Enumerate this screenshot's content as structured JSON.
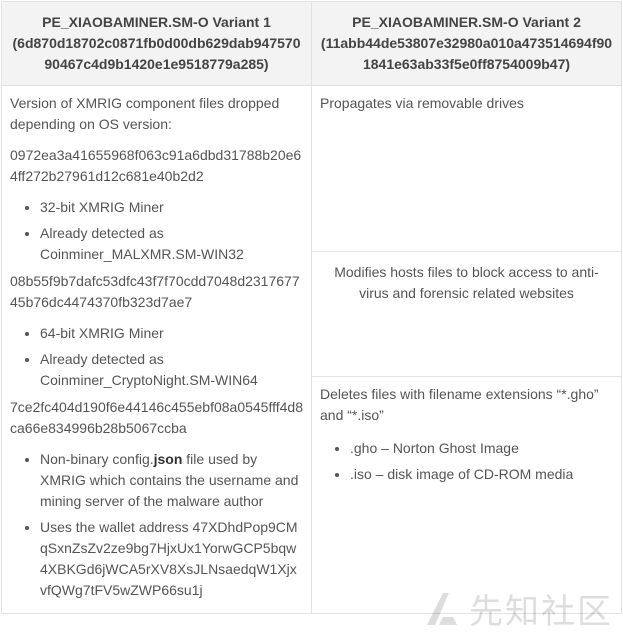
{
  "header": {
    "variant1": "PE_XIAOBAMINER.SM-O Variant 1 (6d870d18702c0871fb0d00db629dab947570 90467c4d9b1420e1e9518779a285)",
    "variant2": "PE_XIAOBAMINER.SM-O Variant 2 (11abb44de53807e32980a010a473514694f90 1841e63ab33f5e0ff8754009b47)"
  },
  "variant1": {
    "intro": "Version of XMRIG component files dropped depending on OS version:",
    "hash1": "0972ea3a41655968f063c91a6dbd31788b20e64ff272b27961d12c681e40b2d2",
    "list1": [
      "32-bit XMRIG Miner",
      "Already detected as Coinminer_MALXMR.SM-WIN32"
    ],
    "hash2": "08b55f9b7dafc53dfc43f7f70cdd7048d231767745b76dc4474370fb323d7ae7",
    "list2": [
      "64-bit XMRIG Miner",
      "Already detected as Coinminer_CryptoNight.SM-WIN64"
    ],
    "hash3": "7ce2fc404d190f6e44146c455ebf08a0545fff4d8ca66e834996b28b5067ccba",
    "config_pre": "Non-binary config.",
    "config_bold": "json",
    "config_post": " file used by XMRIG which contains the username and mining server of the malware author",
    "wallet": "Uses the wallet address 47XDhdPop9CMqSxnZsZv2ze9bg7HjxUx1YorwGCP5bqw4XBKGd6jWCA5rXV8XsJLNsaedqW1XjxvfQWg7tFV5wZWP66su1j"
  },
  "variant2": {
    "propagates": "Propagates via removable drives",
    "hosts": "Modifies hosts files to block access to anti-virus and forensic related websites",
    "deletes": "Deletes files with filename extensions “*.gho” and “*.iso”",
    "ext_list": [
      ".gho – Norton Ghost Image",
      ".iso – disk image of CD-ROM media"
    ]
  },
  "watermark": {
    "text": "先知社区"
  }
}
